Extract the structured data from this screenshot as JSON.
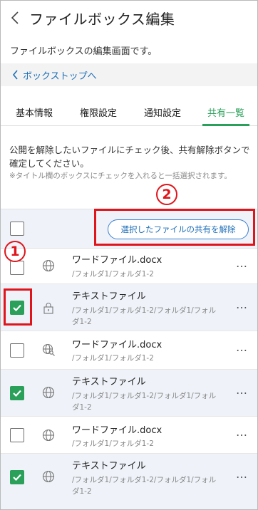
{
  "header": {
    "title": "ファイルボックス編集"
  },
  "subtitle": "ファイルボックスの編集画面です。",
  "backlink": {
    "label": "ボックストップへ"
  },
  "tabs": [
    {
      "label": "基本情報",
      "active": false
    },
    {
      "label": "権限設定",
      "active": false
    },
    {
      "label": "通知設定",
      "active": false
    },
    {
      "label": "共有一覧",
      "active": true
    }
  ],
  "instructions": {
    "main": "公開を解除したいファイルにチェック後、共有解除ボタンで確定してください。",
    "note": "※タイトル欄のボックスにチェックを入れると一括選択されます。"
  },
  "toolbar": {
    "action_label": "選択したファイルの共有を解除"
  },
  "annotations": {
    "one": "1",
    "two": "2"
  },
  "files": [
    {
      "name": "ワードファイル.docx",
      "path": "/フォルダ1/フォルダ1-2",
      "checked": false,
      "icon": "globe-icon",
      "more": "…"
    },
    {
      "name": "テキストファイル",
      "path": "/フォルダ1/フォルダ1-2/フォルダ1/フォルダ1-2",
      "checked": true,
      "icon": "lock-icon",
      "more": "…"
    },
    {
      "name": "ワードファイル.docx",
      "path": "/フォルダ1/フォルダ1-2",
      "checked": false,
      "icon": "globe-key-icon",
      "more": "…"
    },
    {
      "name": "テキストファイル",
      "path": "/フォルダ1/フォルダ1-2/フォルダ1/フォルダ1-2",
      "checked": true,
      "icon": "globe-icon",
      "more": "…"
    },
    {
      "name": "ワードファイル.docx",
      "path": "/フォルダ1/フォルダ1-2",
      "checked": false,
      "icon": "globe-icon",
      "more": "…"
    },
    {
      "name": "テキストファイル",
      "path": "/フォルダ1/フォルダ1-2/フォルダ1/フォルダ1-2",
      "checked": true,
      "icon": "globe-icon",
      "more": "…"
    }
  ],
  "colors": {
    "accent_green": "#2aa05a",
    "link_blue": "#1d6fb8",
    "annotation_red": "#e0141b",
    "row_alt_bg": "#eff3f9"
  }
}
